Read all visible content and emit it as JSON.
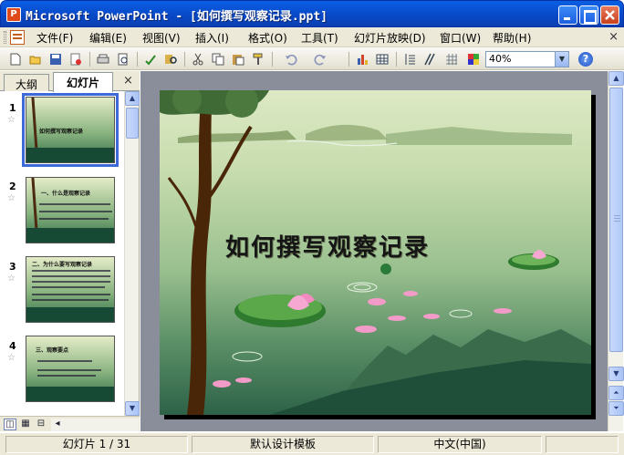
{
  "window": {
    "app_icon_letter": "P",
    "title": "Microsoft PowerPoint - [如何撰写观察记录.ppt]"
  },
  "menubar": {
    "items": [
      "文件(F)",
      "编辑(E)",
      "视图(V)",
      "插入(I)",
      "格式(O)",
      "工具(T)",
      "幻灯片放映(D)",
      "窗口(W)",
      "帮助(H)"
    ],
    "close_glyph": "×"
  },
  "toolbar": {
    "zoom_value": "40%",
    "help_glyph": "?"
  },
  "leftpane": {
    "tabs": [
      "大纲",
      "幻灯片"
    ],
    "active_tab": "幻灯片",
    "close_glyph": "×",
    "thumbnails": [
      {
        "number": "1",
        "title": "如何撰写观察记录"
      },
      {
        "number": "2",
        "title": "一、什么是观察记录"
      },
      {
        "number": "3",
        "title": "二、为什么要写观察记录"
      },
      {
        "number": "4",
        "title": "三、观察要点"
      }
    ]
  },
  "slide": {
    "title": "如何撰写观察记录"
  },
  "statusbar": {
    "slide_position": "幻灯片 1 / 31",
    "template": "默认设计模板",
    "language": "中文(中国)"
  },
  "colors": {
    "titlebar": "#0a5fe4",
    "chrome": "#ece9d8",
    "selection": "#3d6ad6",
    "slide_dark_green": "#174a35"
  }
}
